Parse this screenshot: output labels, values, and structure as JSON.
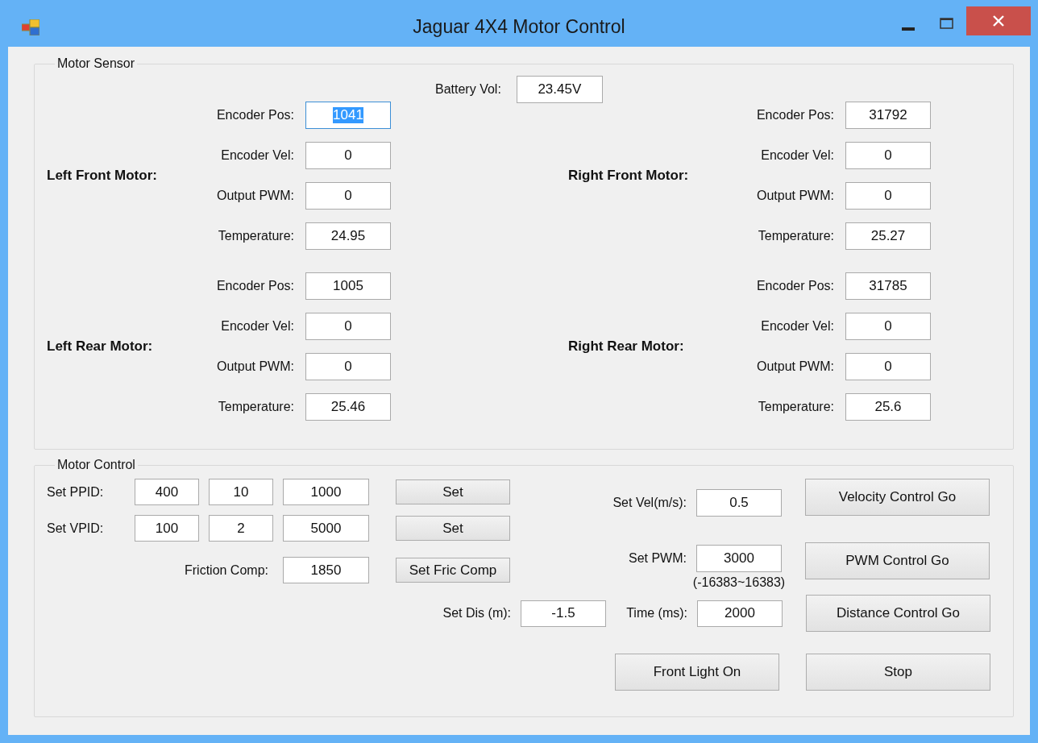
{
  "window": {
    "title": "Jaguar 4X4 Motor Control"
  },
  "motor_sensor": {
    "title": "Motor Sensor",
    "battery": {
      "label": "Battery Vol:",
      "value": "23.45V"
    },
    "motors": [
      {
        "name": "Left Front Motor:",
        "fields": [
          {
            "label": "Encoder Pos:",
            "value": "1041",
            "focused": true
          },
          {
            "label": "Encoder Vel:",
            "value": "0",
            "focused": false
          },
          {
            "label": "Output PWM:",
            "value": "0",
            "focused": false
          },
          {
            "label": "Temperature:",
            "value": "24.95",
            "focused": false
          }
        ]
      },
      {
        "name": "Right Front Motor:",
        "fields": [
          {
            "label": "Encoder Pos:",
            "value": "31792",
            "focused": false
          },
          {
            "label": "Encoder Vel:",
            "value": "0",
            "focused": false
          },
          {
            "label": "Output PWM:",
            "value": "0",
            "focused": false
          },
          {
            "label": "Temperature:",
            "value": "25.27",
            "focused": false
          }
        ]
      },
      {
        "name": "Left Rear Motor:",
        "fields": [
          {
            "label": "Encoder Pos:",
            "value": "1005",
            "focused": false
          },
          {
            "label": "Encoder Vel:",
            "value": "0",
            "focused": false
          },
          {
            "label": "Output PWM:",
            "value": "0",
            "focused": false
          },
          {
            "label": "Temperature:",
            "value": "25.46",
            "focused": false
          }
        ]
      },
      {
        "name": "Right Rear Motor:",
        "fields": [
          {
            "label": "Encoder Pos:",
            "value": "31785",
            "focused": false
          },
          {
            "label": "Encoder Vel:",
            "value": "0",
            "focused": false
          },
          {
            "label": "Output PWM:",
            "value": "0",
            "focused": false
          },
          {
            "label": "Temperature:",
            "value": "25.6",
            "focused": false
          }
        ]
      }
    ]
  },
  "motor_control": {
    "title": "Motor Control",
    "pid_rows": [
      {
        "label": "Set PPID:",
        "values": [
          "400",
          "10",
          "1000"
        ],
        "button": "Set"
      },
      {
        "label": "Set VPID:",
        "values": [
          "100",
          "2",
          "5000"
        ],
        "button": "Set"
      }
    ],
    "friction": {
      "label": "Friction Comp:",
      "value": "1850",
      "button": "Set Fric Comp"
    },
    "velocity": {
      "label": "Set Vel(m/s):",
      "value": "0.5",
      "button": "Velocity Control Go"
    },
    "pwm": {
      "label": "Set PWM:",
      "value": "3000",
      "range": "(-16383~16383)",
      "button": "PWM Control Go"
    },
    "distance": {
      "label": "Set Dis (m):",
      "value": "-1.5",
      "time_label": "Time (ms):",
      "time_value": "2000",
      "button": "Distance Control Go"
    },
    "buttons": [
      "Front Light On",
      "Stop"
    ]
  }
}
